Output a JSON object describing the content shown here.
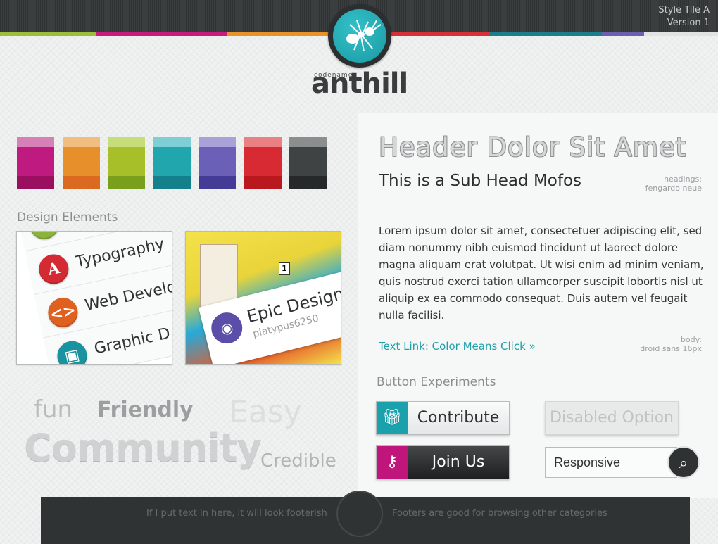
{
  "header": {
    "tile_name": "Style Tile A",
    "version": "Version 1",
    "logo": {
      "icon": "ant-icon",
      "sub": "codename",
      "word": "anthill"
    }
  },
  "colors": {
    "stripe": [
      "#9dbe3a",
      "#c71c7c",
      "#e8922a",
      "#d83038",
      "#1b7e8a",
      "#6a5fb0",
      "#e0e3e3"
    ],
    "swatches": [
      [
        "#d77fb7",
        "#bf1a7f",
        "#9a0f60"
      ],
      [
        "#f2bd80",
        "#e78f2a",
        "#db6a20"
      ],
      [
        "#c6dd7b",
        "#a7c02a",
        "#7a9f1d"
      ],
      [
        "#7ecfd5",
        "#22a6ae",
        "#13808c"
      ],
      [
        "#a8a2d9",
        "#6a60b8",
        "#433b96"
      ],
      [
        "#ea8084",
        "#d82a32",
        "#b9181f"
      ],
      [
        "#8a8e8f",
        "#3f4344",
        "#25292a"
      ]
    ]
  },
  "design_elements": {
    "title": "Design Elements",
    "menu": [
      {
        "icon": "typography-icon",
        "label": "Typography",
        "color": "#d32a33"
      },
      {
        "icon": "code-icon",
        "label": "Web Develo",
        "color": "#e0601f"
      },
      {
        "icon": "image-icon",
        "label": "Graphic D",
        "color": "#1a93a0"
      }
    ],
    "game": {
      "title": "Epic Design T",
      "user": "platypus6250",
      "icon": "camera-icon",
      "badge": "1"
    }
  },
  "word_cloud": [
    "fun",
    "Friendly",
    "Easy",
    "Community",
    "Credible"
  ],
  "panel": {
    "header": "Header Dolor Sit Amet",
    "subhead": "This is a Sub Head Mofos",
    "headings_note": [
      "headings:",
      "fengardo neue"
    ],
    "body": "Lorem ipsum dolor sit amet, consectetuer adipiscing elit, sed diam nonummy nibh euismod tincidunt ut laoreet dolore magna aliquam erat volutpat. Ut wisi enim ad minim veniam, quis nostrud exerci tation ullamcorper suscipit lobortis nisl ut aliquip ex ea commodo consequat. Duis autem vel feugait nulla facilisi.",
    "body_note": [
      "body:",
      "droid sans 16px"
    ],
    "link": "Text Link: Color Means Click »",
    "buttons_title": "Button Experiments",
    "contribute": "Contribute",
    "join": "Join Us",
    "disabled": "Disabled Option",
    "search_value": "Responsive"
  },
  "footer": {
    "left": "If I put text in here, it will look footerish",
    "right": "Footers are good for browsing other categories"
  }
}
